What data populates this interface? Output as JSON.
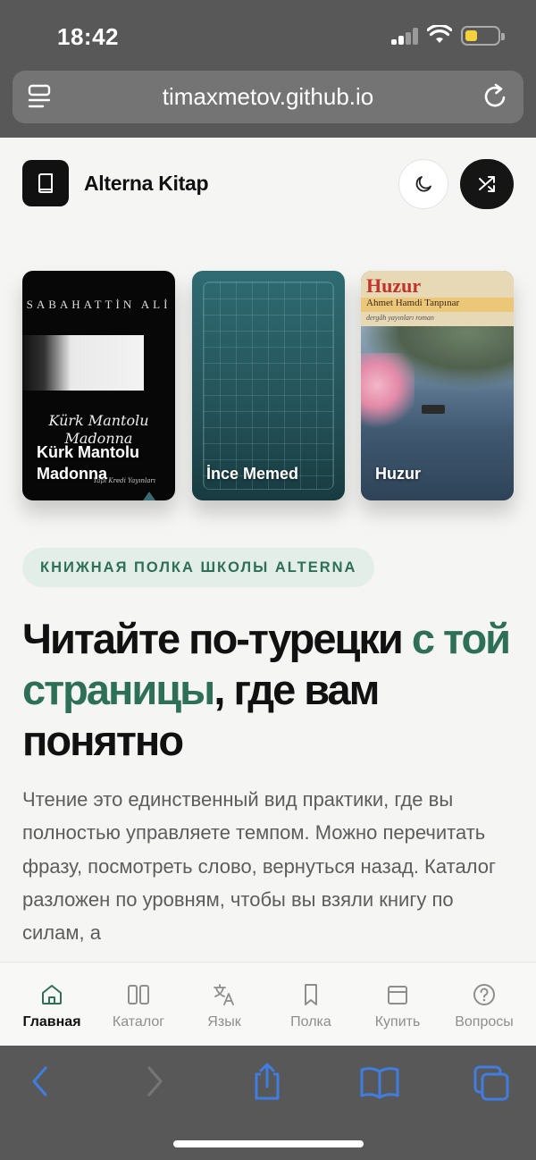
{
  "status_bar": {
    "time": "18:42",
    "battery_color": "#f5d13b"
  },
  "browser": {
    "url": "timaxmetov.github.io"
  },
  "header": {
    "brand": "Alterna Kitap",
    "logo_icon": "book-icon",
    "theme_icon": "moon-icon",
    "shuffle_icon": "shuffle-icon"
  },
  "books": [
    {
      "title": "Kürk Mantolu Madonna",
      "cover_author": "SABAHATTİN ALİ",
      "cover_script": "Kürk Mantolu Madonna",
      "cover_publisher": "Yapı Kredi Yayınları"
    },
    {
      "title": "İnce Memed"
    },
    {
      "title": "Huzur",
      "cover_title": "Huzur",
      "cover_author": "Ahmet Hamdi Tanpınar",
      "cover_subtitle": "dergâh yayınları  roman"
    }
  ],
  "hero": {
    "tag": "КНИЖНАЯ ПОЛКА ШКОЛЫ ALTERNA",
    "headline_before": "Читайте по-турецки ",
    "headline_accent": "с той страницы",
    "headline_after": ", где вам понятно",
    "body": "Чтение это единственный вид практики, где вы полностью управляете темпом. Можно перечитать фразу, посмотреть слово, вернуться назад. Каталог разложен по уровням, чтобы вы взяли книгу по силам, а"
  },
  "tabs": [
    {
      "label": "Главная",
      "icon": "home-icon",
      "active": true
    },
    {
      "label": "Каталог",
      "icon": "columns-icon",
      "active": false
    },
    {
      "label": "Язык",
      "icon": "translate-icon",
      "active": false
    },
    {
      "label": "Полка",
      "icon": "bookmark-icon",
      "active": false
    },
    {
      "label": "Купить",
      "icon": "card-icon",
      "active": false
    },
    {
      "label": "Вопросы",
      "icon": "question-icon",
      "active": false
    }
  ],
  "colors": {
    "accent": "#2e6f57",
    "tag_bg": "#e3eee8",
    "safari_blue": "#3f7de0"
  }
}
